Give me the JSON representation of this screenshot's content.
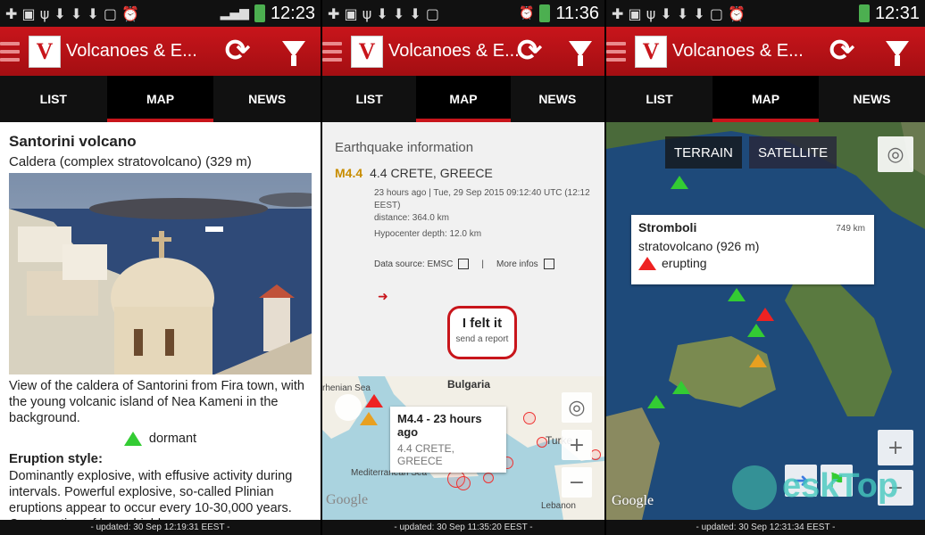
{
  "app_title": "Volcanoes & E...",
  "tabs": [
    "LIST",
    "MAP",
    "NEWS"
  ],
  "panels": [
    {
      "time": "12:23",
      "footer": "- updated: 30 Sep 12:19:31 EEST -",
      "volcano_name": "Santorini volcano",
      "volcano_type": "Caldera (complex stratovolcano) (329 m)",
      "caption": "View of the caldera of Santorini from Fira town, with the young volcanic island of Nea Kameni in the background.",
      "status": "dormant",
      "eruption_style_heading": "Eruption style:",
      "eruption_style_text": "Dominantly explosive, with effusive activity during intervals. Powerful explosive, so-called Plinian eruptions appear to occur every 10-30,000 years. Construction of lava shields"
    },
    {
      "time": "11:36",
      "footer": "- updated: 30 Sep 11:35:20 EEST -",
      "eq_heading": "Earthquake information",
      "magnitude": "M4.4",
      "location": "4.4  CRETE, GREECE",
      "detail_time": "23 hours ago | Tue, 29 Sep 2015 09:12:40 UTC (12:12 EEST)",
      "distance": "distance: 364.0 km",
      "depth": "Hypocenter depth: 12.0 km",
      "data_source": "Data source: EMSC",
      "separator": "|",
      "more_infos": "More infos",
      "felt_title": "I felt it",
      "felt_sub": "send a report",
      "info_title": "M4.4  -  23 hours ago",
      "info_sub": "4.4  CRETE, GREECE",
      "map_labels": {
        "bulgaria": "Bulgaria",
        "sea": "Mediterranean Sea",
        "lebanon": "Lebanon",
        "tyrrhenian": "rhenian Sea",
        "turkey": "Turke"
      },
      "google": "Google"
    },
    {
      "time": "12:31",
      "footer": "- updated: 30 Sep 12:31:34 EEST -",
      "terrain": "TERRAIN",
      "satellite": "SATELLITE",
      "volcano_name": "Stromboli",
      "volcano_type": "stratovolcano (926 m)",
      "distance": "749 km",
      "status": "erupting",
      "google": "Google"
    }
  ],
  "map_controls": {
    "zoom_in": "+",
    "zoom_out": "−",
    "locate": "◎"
  },
  "watermark": "eskTop",
  "colors": {
    "brand_red": "#c8151b",
    "dormant_green": "#33cc33",
    "erupting_red": "#e22222",
    "magnitude_gold": "#c88d00"
  }
}
